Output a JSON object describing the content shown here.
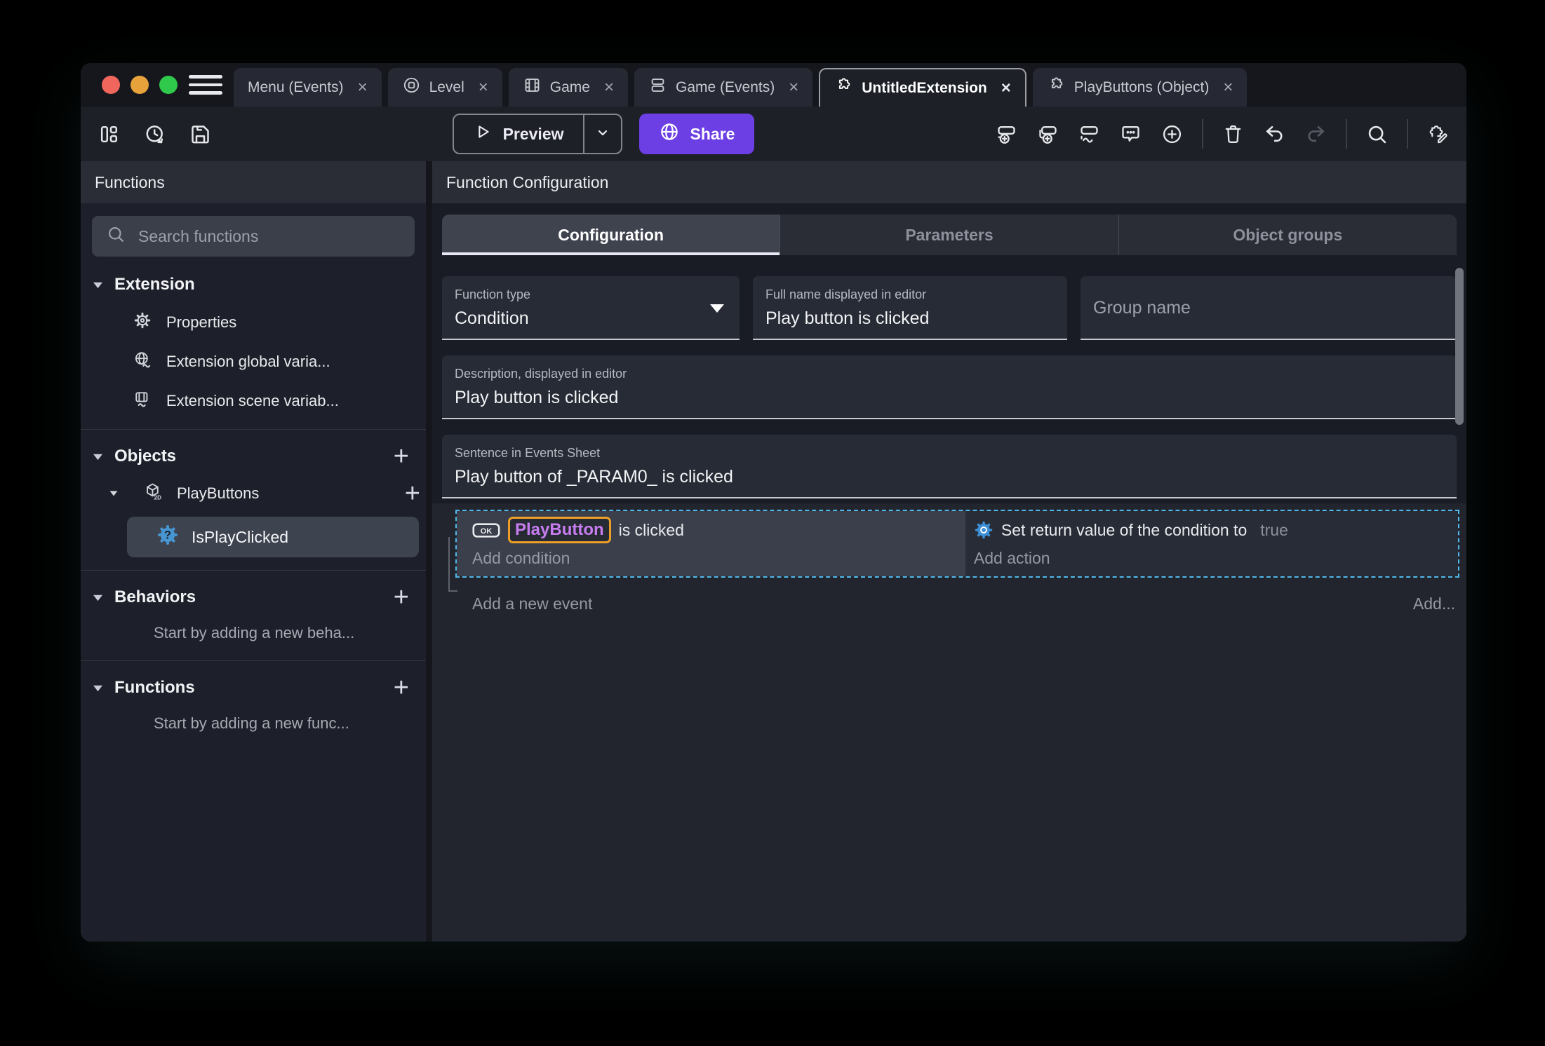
{
  "glyphs": {
    "close": "×",
    "plus": "+"
  },
  "window": {
    "tabs": [
      {
        "label": "Menu (Events)"
      },
      {
        "label": "Level"
      },
      {
        "label": "Game"
      },
      {
        "label": "Game (Events)"
      },
      {
        "label": "UntitledExtension",
        "active": true
      },
      {
        "label": "PlayButtons (Object)"
      }
    ]
  },
  "toolbar": {
    "preview_label": "Preview",
    "share_label": "Share"
  },
  "sidebar": {
    "title": "Functions",
    "search_placeholder": "Search functions",
    "sections": [
      {
        "title": "Extension",
        "items": [
          {
            "label": "Properties"
          },
          {
            "label": "Extension global varia..."
          },
          {
            "label": "Extension scene variab..."
          }
        ]
      },
      {
        "title": "Objects",
        "add": "+",
        "items": [
          {
            "label": "PlayButtons",
            "add": "+",
            "children": [
              {
                "label": "IsPlayClicked",
                "selected": true
              }
            ]
          }
        ]
      },
      {
        "title": "Behaviors",
        "add": "+",
        "empty": "Start by adding a new beha..."
      },
      {
        "title": "Functions",
        "add": "+",
        "empty": "Start by adding a new func..."
      }
    ]
  },
  "main": {
    "panel_title": "Function Configuration",
    "tabs": [
      {
        "label": "Configuration",
        "active": true
      },
      {
        "label": "Parameters"
      },
      {
        "label": "Object groups"
      }
    ],
    "form": {
      "function_type": {
        "label": "Function type",
        "value": "Condition"
      },
      "full_name": {
        "label": "Full name displayed in editor",
        "value": "Play button is clicked"
      },
      "group_name": {
        "placeholder": "Group name"
      },
      "description": {
        "label": "Description, displayed in editor",
        "value": "Play button is clicked"
      },
      "sentence": {
        "label": "Sentence in Events Sheet",
        "value": "Play button of _PARAM0_ is clicked"
      }
    },
    "events": {
      "condition_object": "PlayButton",
      "condition_text": "is clicked",
      "add_condition": "Add condition",
      "action_text": "Set return value of the condition to",
      "action_value": "true",
      "add_action": "Add action",
      "add_new_event": "Add a new event",
      "add_more": "Add..."
    }
  },
  "colors": {
    "window_bg": "#1D2027",
    "tabbar_bg": "#15171D",
    "sidebar_bg": "#1D202A",
    "main_bg": "#191C24",
    "panel_header_bg": "#2A2D36",
    "events_bg": "#22252E",
    "condition_bg": "#3A3F4B",
    "action_bg": "#282C36",
    "share_purple": "#6C3FE4",
    "object_purple": "#C77DF0",
    "highlight_orange": "#ED9E28",
    "selection_blue": "#4FB8E8",
    "action_gear_blue": "#3D8FD6",
    "condition_icon_blue": "#4796D2",
    "traffic_red": "#F0665C",
    "traffic_yellow": "#E8A23C",
    "traffic_green": "#2FC94C"
  }
}
